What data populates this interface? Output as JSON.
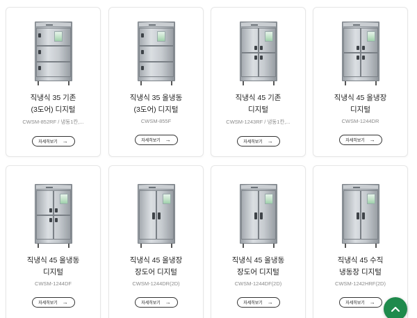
{
  "products": [
    {
      "name": "직냉식 35 기존\n(3도어) 디지털",
      "code": "CWSM-852RF / 냉동1칸,...",
      "button": "자세히보기",
      "type": "3door"
    },
    {
      "name": "직냉식 35 올냉동\n(3도어) 디지털",
      "code": "CWSM-855F",
      "button": "자세히보기",
      "type": "3door"
    },
    {
      "name": "직냉식 45 기존\n디지털",
      "code": "CWSM-1243RF / 냉동1칸,...",
      "button": "자세히보기",
      "type": "4door"
    },
    {
      "name": "직냉식 45 올냉장\n디지털",
      "code": "CWSM-1244DR",
      "button": "자세히보기",
      "type": "4door"
    },
    {
      "name": "직냉식 45 올냉동\n디지털",
      "code": "CWSM-1244DF",
      "button": "자세히보기",
      "type": "4door"
    },
    {
      "name": "직냉식 45 올냉장\n장도어 디지털",
      "code": "CWSM-1244DR(2D)",
      "button": "자세히보기",
      "type": "2door"
    },
    {
      "name": "직냉식 45 올냉동\n장도어 디지털",
      "code": "CWSM-1244DF(2D)",
      "button": "자세히보기",
      "type": "2door"
    },
    {
      "name": "직냉식 45 수직\n냉동장 디지털",
      "code": "CWSM-1242HRF(2D)",
      "button": "자세히보기",
      "type": "2door"
    }
  ],
  "arrow_icon": "arrow-right-icon",
  "scroll_top_icon": "chevron-up-icon",
  "colors": {
    "accent": "#1f8a4c",
    "border": "#e6e6e6"
  }
}
